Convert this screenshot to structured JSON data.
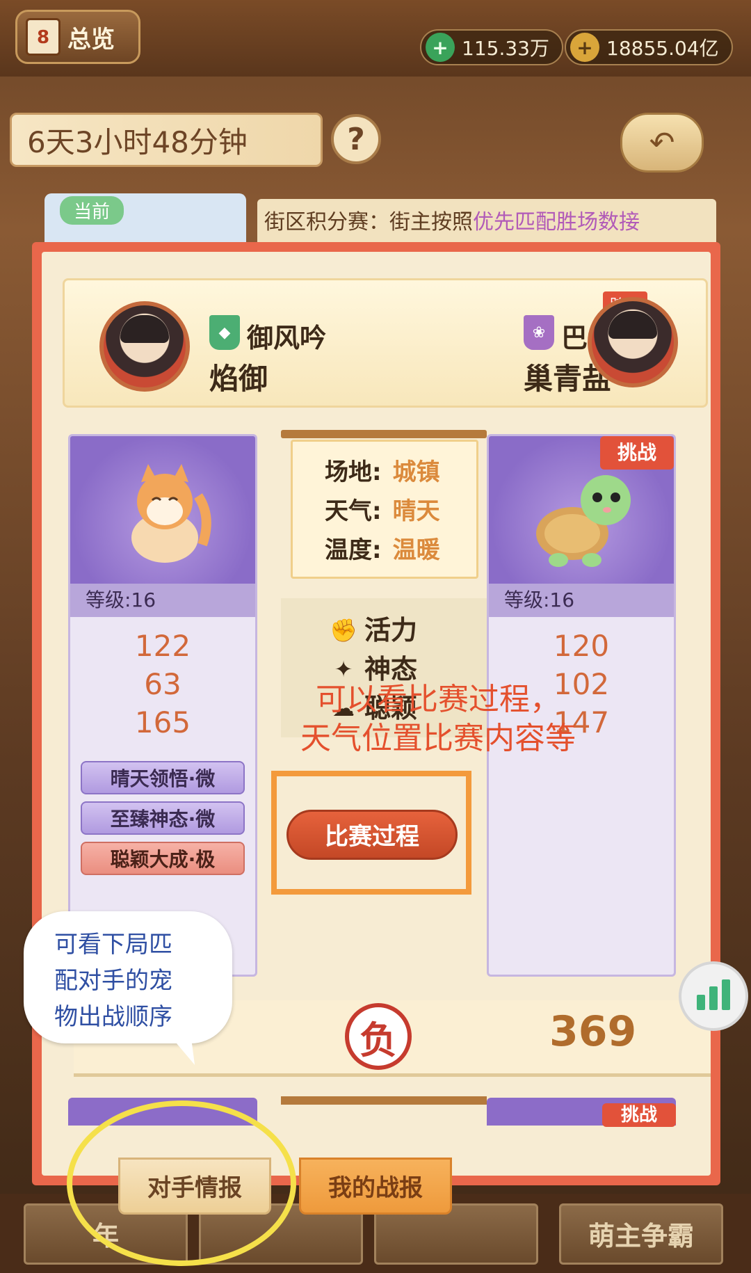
{
  "topbar": {
    "overview_label": "总览",
    "calendar_digit": "8",
    "currency1": "115.33万",
    "currency2": "18855.04亿"
  },
  "timer": {
    "text": "6天3小时48分钟"
  },
  "help_label": "?",
  "background_info": {
    "tag": "当前",
    "text_prefix": "街区积分赛：街主按照",
    "text_highlight": "优先匹配胜场数接"
  },
  "players": {
    "left": {
      "guild": "御风吟",
      "name": "焰御"
    },
    "right": {
      "guild": "巴士",
      "name": "巢青盐",
      "cross_server_tag": "跨服"
    }
  },
  "environment": {
    "rows": [
      {
        "label": "场地:",
        "value": "城镇"
      },
      {
        "label": "天气:",
        "value": "晴天"
      },
      {
        "label": "温度:",
        "value": "温暖"
      }
    ]
  },
  "attributes": [
    {
      "icon": "fist-icon",
      "label": "活力"
    },
    {
      "icon": "sparkle-icon",
      "label": "神态"
    },
    {
      "icon": "cloud-icon",
      "label": "聪颖"
    }
  ],
  "pets": {
    "left": {
      "level": "等级:16",
      "stats": [
        "122",
        "63",
        "165"
      ],
      "skills": [
        "晴天领悟·微",
        "至臻神态·微",
        "聪颖大成·极"
      ]
    },
    "right": {
      "level": "等级:16",
      "stats": [
        "120",
        "102",
        "147"
      ],
      "challenge": "挑战"
    }
  },
  "annotation_note": [
    "可以看比赛过程，",
    "天气位置比赛内容等"
  ],
  "match_button": "比赛过程",
  "result": {
    "mark": "负",
    "score": "369"
  },
  "peek_challenge": "挑战",
  "tabs": {
    "enemy": "对手情报",
    "mine": "我的战报"
  },
  "bottom_nav": [
    "年",
    "",
    "",
    "萌主争霸"
  ],
  "bubble_text": [
    "可看下局匹",
    "配对手的宠",
    "物出战顺序"
  ],
  "colors": {
    "panel": "#e9674b",
    "annotation": "#e4502d",
    "highlight_box": "#f39a3c",
    "ellipse": "#f5e04a"
  }
}
